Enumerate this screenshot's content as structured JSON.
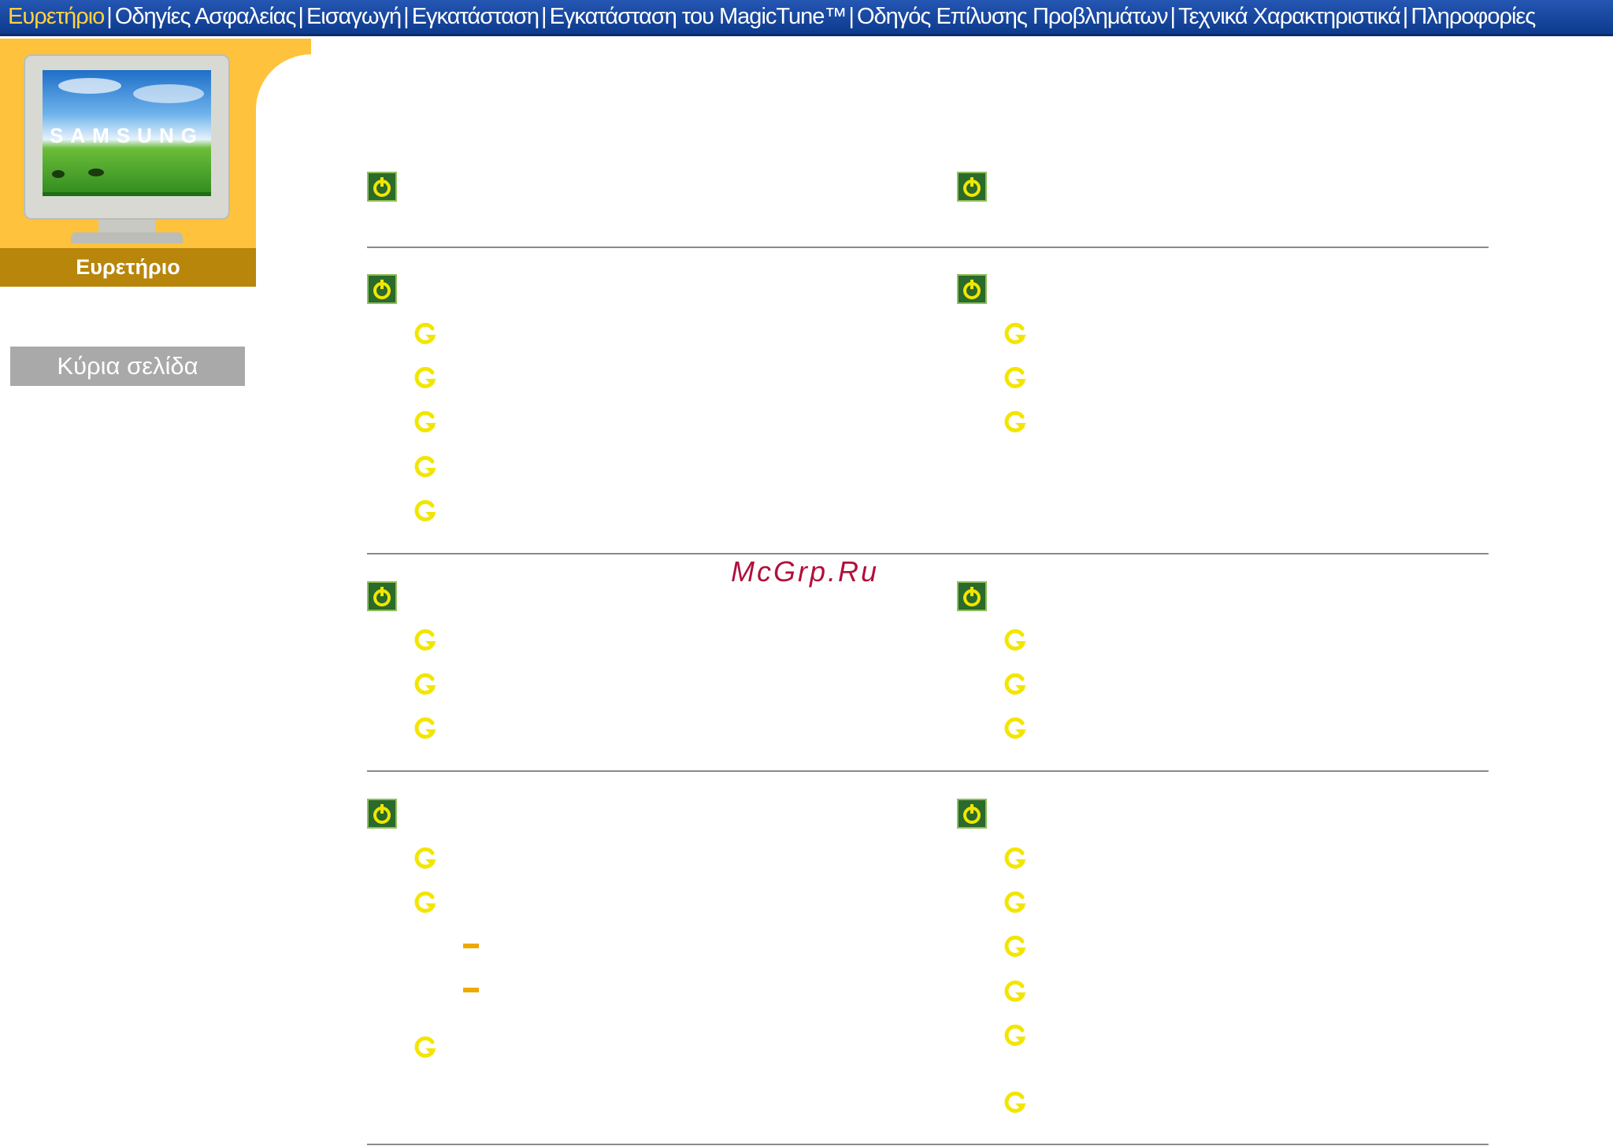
{
  "nav": {
    "items": [
      "Ευρετήριο",
      "Οδηγίες Ασφαλείας",
      "Εισαγωγή",
      "Εγκατάσταση",
      "Εγκατάσταση του MagicTune™",
      "Οδηγός Επίλυσης Προβλημάτων",
      "Τεχνικά Χαρακτηριστικά",
      "Πληροφορίες"
    ],
    "separator": "|",
    "active_index": 0
  },
  "sidebar": {
    "monitor_logo": "SAMSUNG",
    "title": "Ευρετήριο",
    "home_button": "Κύρια σελίδα"
  },
  "watermark": "McGrp.Ru",
  "colors": {
    "nav_background": "#1a4aa3",
    "nav_active": "#ffd23f",
    "sidebar_yellow": "#ffc23d",
    "sidebar_title_bg": "#b8860b",
    "home_button_bg": "#a9a9a9",
    "section_icon": "#2a6a2a",
    "bullet_icon": "#f2e600",
    "dash": "#f0a800"
  },
  "icons": {
    "section": "power-icon",
    "item": "circular-arrow-icon",
    "subitem": "dash-icon"
  }
}
